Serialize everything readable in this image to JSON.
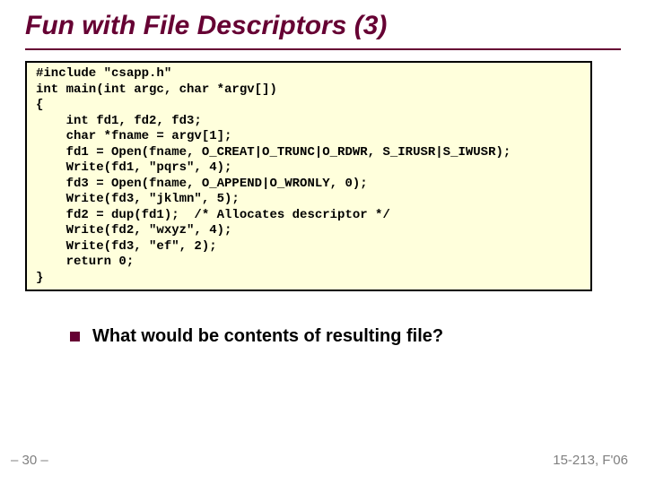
{
  "title": "Fun with File Descriptors (3)",
  "code": "#include \"csapp.h\"\nint main(int argc, char *argv[])\n{\n    int fd1, fd2, fd3;\n    char *fname = argv[1];\n    fd1 = Open(fname, O_CREAT|O_TRUNC|O_RDWR, S_IRUSR|S_IWUSR);\n    Write(fd1, \"pqrs\", 4);\n    fd3 = Open(fname, O_APPEND|O_WRONLY, 0);\n    Write(fd3, \"jklmn\", 5);\n    fd2 = dup(fd1);  /* Allocates descriptor */\n    Write(fd2, \"wxyz\", 4);\n    Write(fd3, \"ef\", 2);\n    return 0;\n}",
  "bullet": "What would be contents of resulting file?",
  "footer": {
    "left": "– 30 –",
    "right": "15-213, F'06"
  }
}
